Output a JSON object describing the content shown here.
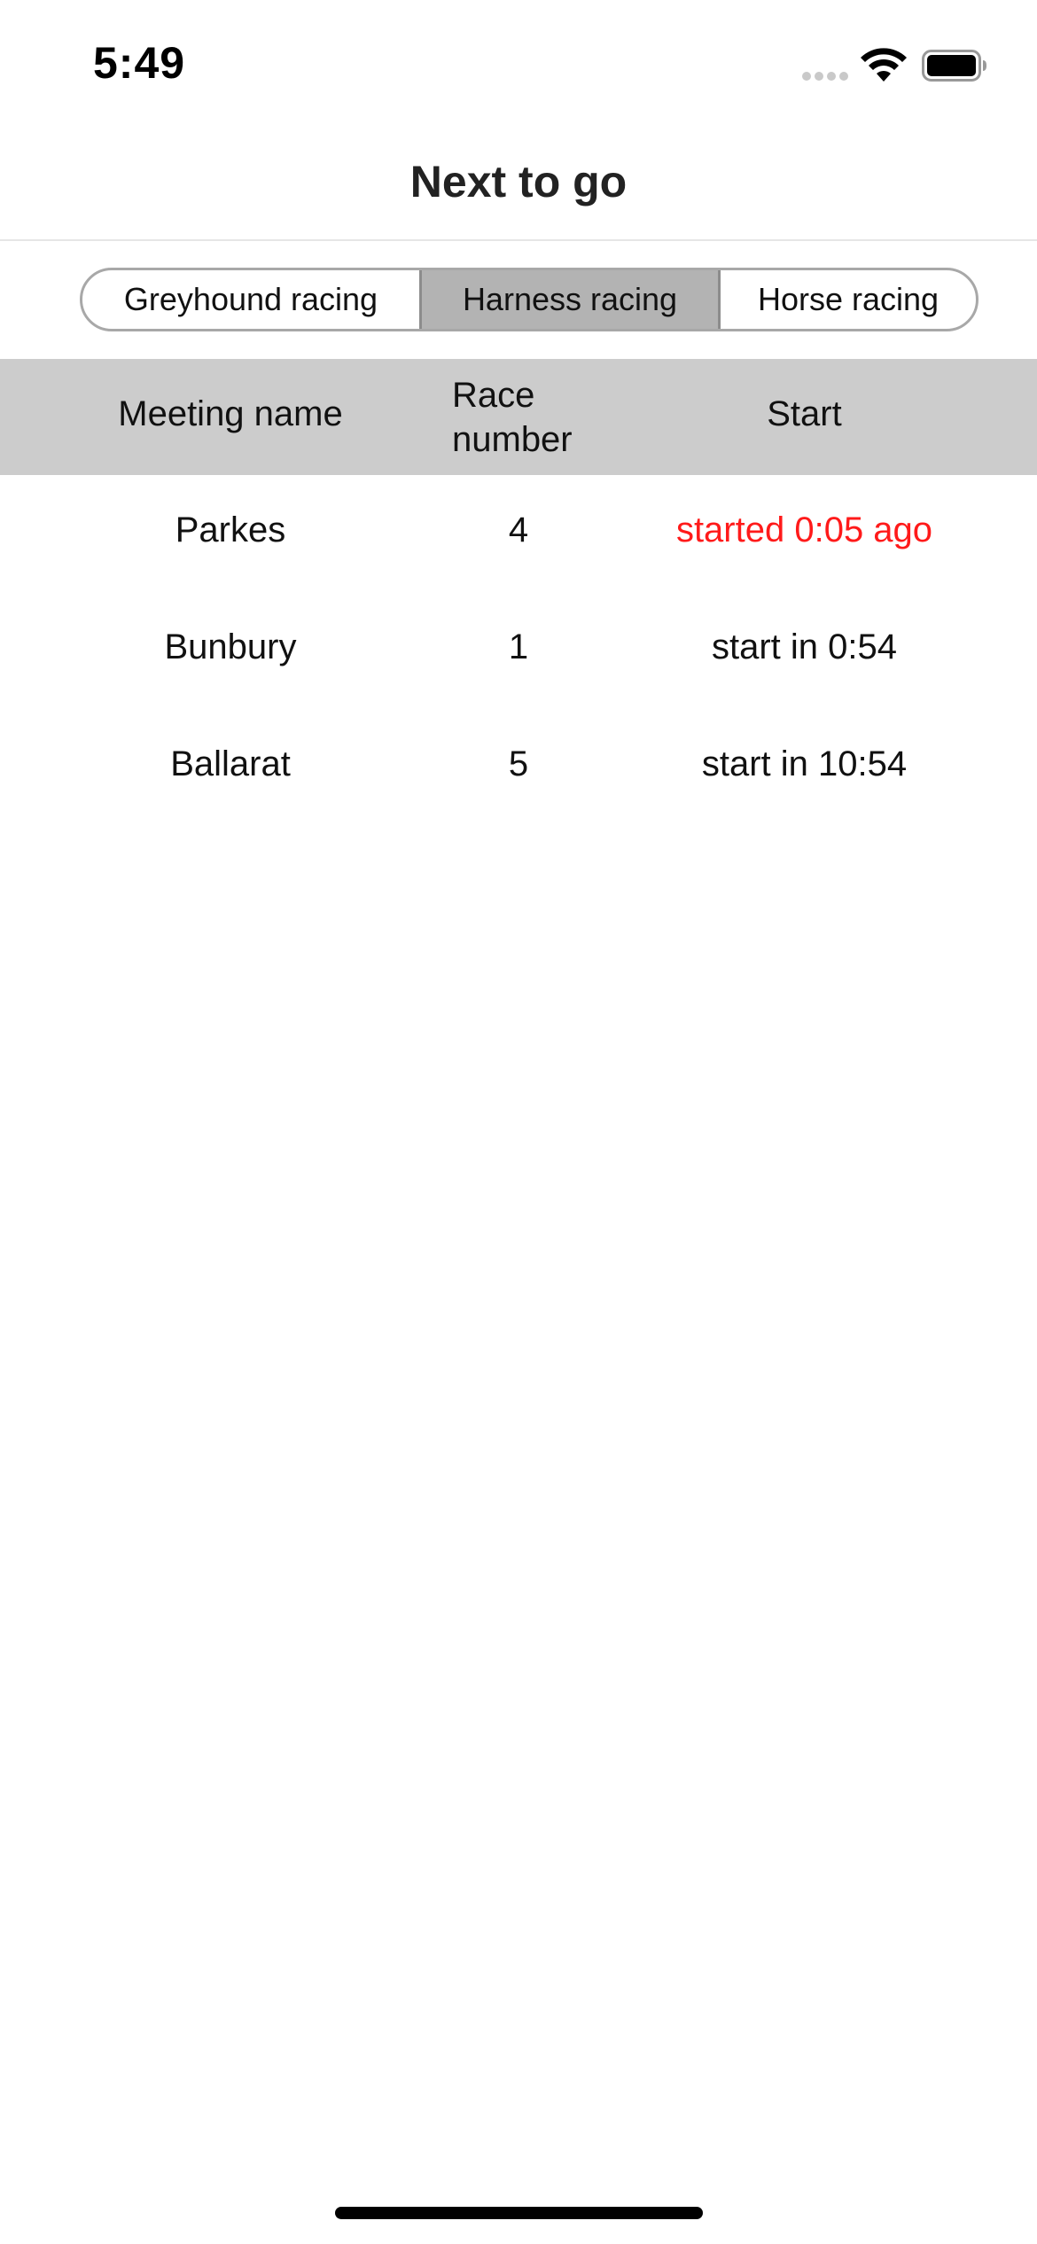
{
  "status_bar": {
    "time": "5:49",
    "icons": [
      "cellular-signal-icon",
      "wifi-icon",
      "battery-icon"
    ]
  },
  "nav": {
    "title": "Next to go"
  },
  "segments": {
    "items": [
      {
        "label": "Greyhound racing",
        "selected": false
      },
      {
        "label": "Harness racing",
        "selected": true
      },
      {
        "label": "Horse racing",
        "selected": false
      }
    ]
  },
  "table": {
    "headers": {
      "meeting": "Meeting name",
      "race_line1": "Race",
      "race_line2": "number",
      "start": "Start"
    },
    "rows": [
      {
        "meeting": "Parkes",
        "race": "4",
        "start": "started 0:05 ago",
        "status": "started"
      },
      {
        "meeting": "Bunbury",
        "race": "1",
        "start": "start in 0:54",
        "status": "upcoming"
      },
      {
        "meeting": "Ballarat",
        "race": "5",
        "start": "start in 10:54",
        "status": "upcoming"
      }
    ]
  },
  "colors": {
    "header_bg": "#cccccc",
    "selected_segment": "#b3b3b3",
    "started_text": "#ff1a1a"
  }
}
